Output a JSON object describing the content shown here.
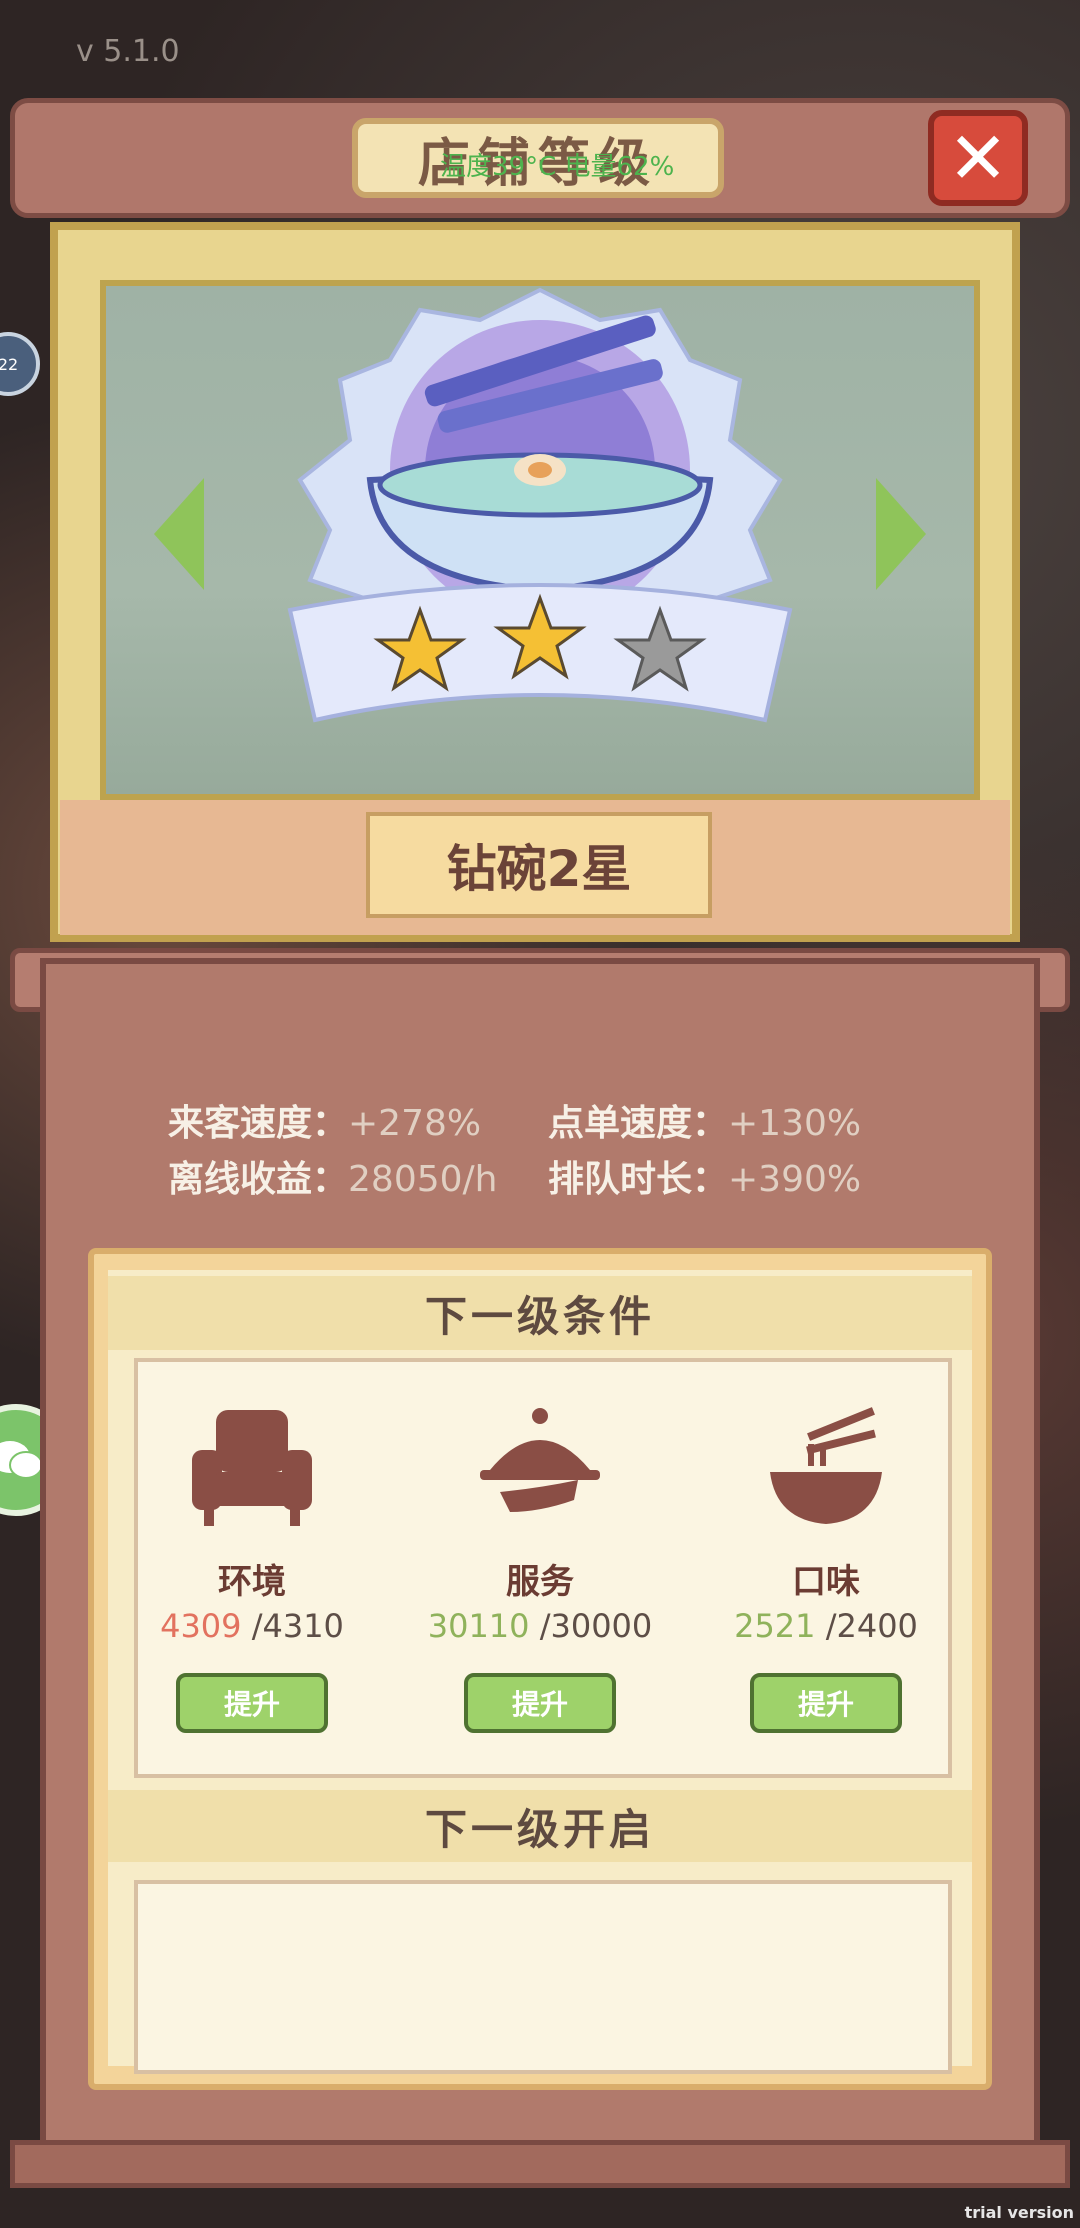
{
  "version": "v 5.1.0",
  "status_overlay": "温度39°C  电量62%",
  "title": "店铺等级",
  "close_label": "✕",
  "side_badge": "22",
  "rank": {
    "name": "钻碗2星",
    "stars_filled": 2,
    "stars_total": 3
  },
  "stats": [
    {
      "label": "来客速度：",
      "value": "+278%"
    },
    {
      "label": "点单速度：",
      "value": "+130%"
    },
    {
      "label": "离线收益：",
      "value": "28050/h"
    },
    {
      "label": "排队时长：",
      "value": "+390%"
    }
  ],
  "next_conditions": {
    "heading": "下一级条件",
    "items": [
      {
        "name": "环境",
        "current": "4309",
        "target": "/4310",
        "button": "提升",
        "icon": "armchair-icon"
      },
      {
        "name": "服务",
        "current": "30110",
        "target": "/30000",
        "button": "提升",
        "icon": "cloche-icon"
      },
      {
        "name": "口味",
        "current": "2521",
        "target": "/2400",
        "button": "提升",
        "icon": "noodle-bowl-icon"
      }
    ]
  },
  "next_unlock": {
    "heading": "下一级开启"
  },
  "trial": "trial version",
  "colors": {
    "accent_green": "#9ed26a",
    "red_value": "#e2725f",
    "green_value": "#8fb25b"
  }
}
